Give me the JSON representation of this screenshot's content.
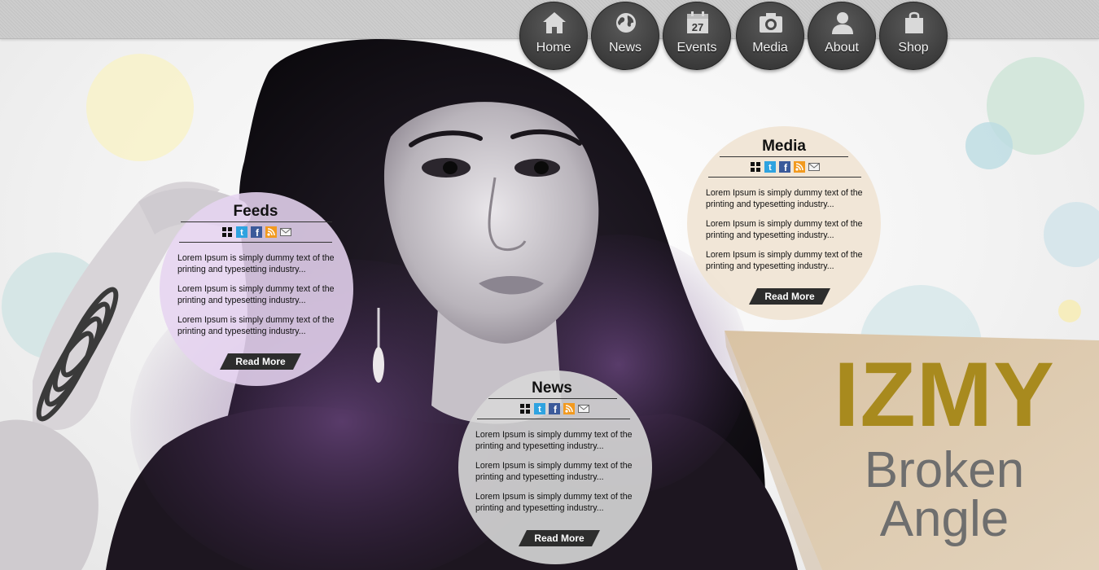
{
  "nav": {
    "items": [
      {
        "label": "Home",
        "icon": "house-icon"
      },
      {
        "label": "News",
        "icon": "globe-icon"
      },
      {
        "label": "Events",
        "icon": "calendar-icon",
        "badge": "27"
      },
      {
        "label": "Media",
        "icon": "camera-icon"
      },
      {
        "label": "About",
        "icon": "person-icon"
      },
      {
        "label": "Shop",
        "icon": "shopping-bag-icon"
      }
    ]
  },
  "social_icons": [
    "grid-icon",
    "twitter-icon",
    "facebook-icon",
    "rss-icon",
    "mail-icon"
  ],
  "panels": {
    "feeds": {
      "title": "Feeds",
      "items": [
        "Lorem Ipsum is simply dummy text of the printing and typesetting industry...",
        "Lorem Ipsum is simply dummy text of the printing and typesetting industry...",
        "Lorem Ipsum is simply dummy text of the printing and typesetting industry..."
      ],
      "read_more": "Read More"
    },
    "media": {
      "title": "Media",
      "items": [
        "Lorem Ipsum is simply dummy text of the printing and typesetting industry...",
        "Lorem Ipsum is simply dummy text of the printing and typesetting industry...",
        "Lorem Ipsum is simply dummy text of the printing and typesetting industry..."
      ],
      "read_more": "Read More"
    },
    "news": {
      "title": "News",
      "items": [
        "Lorem Ipsum is simply dummy text of the printing and typesetting industry...",
        "Lorem Ipsum is simply dummy text of the printing and typesetting industry...",
        "Lorem Ipsum is simply dummy text of the printing and typesetting industry..."
      ],
      "read_more": "Read More"
    }
  },
  "brand": {
    "name": "IZMY",
    "subtitle_line1": "Broken",
    "subtitle_line2": "Angle"
  },
  "colors": {
    "brand_gold": "#a88a1e",
    "brand_panel": "#dccbb0",
    "subtitle_gray": "#6e6e6e",
    "nav_button": "#3c3c3c",
    "feeds_bubble": "#e4d2ec",
    "media_bubble": "#efe3d3",
    "news_bubble": "#d3d3d3",
    "read_more_bg": "#2d2d2d"
  }
}
